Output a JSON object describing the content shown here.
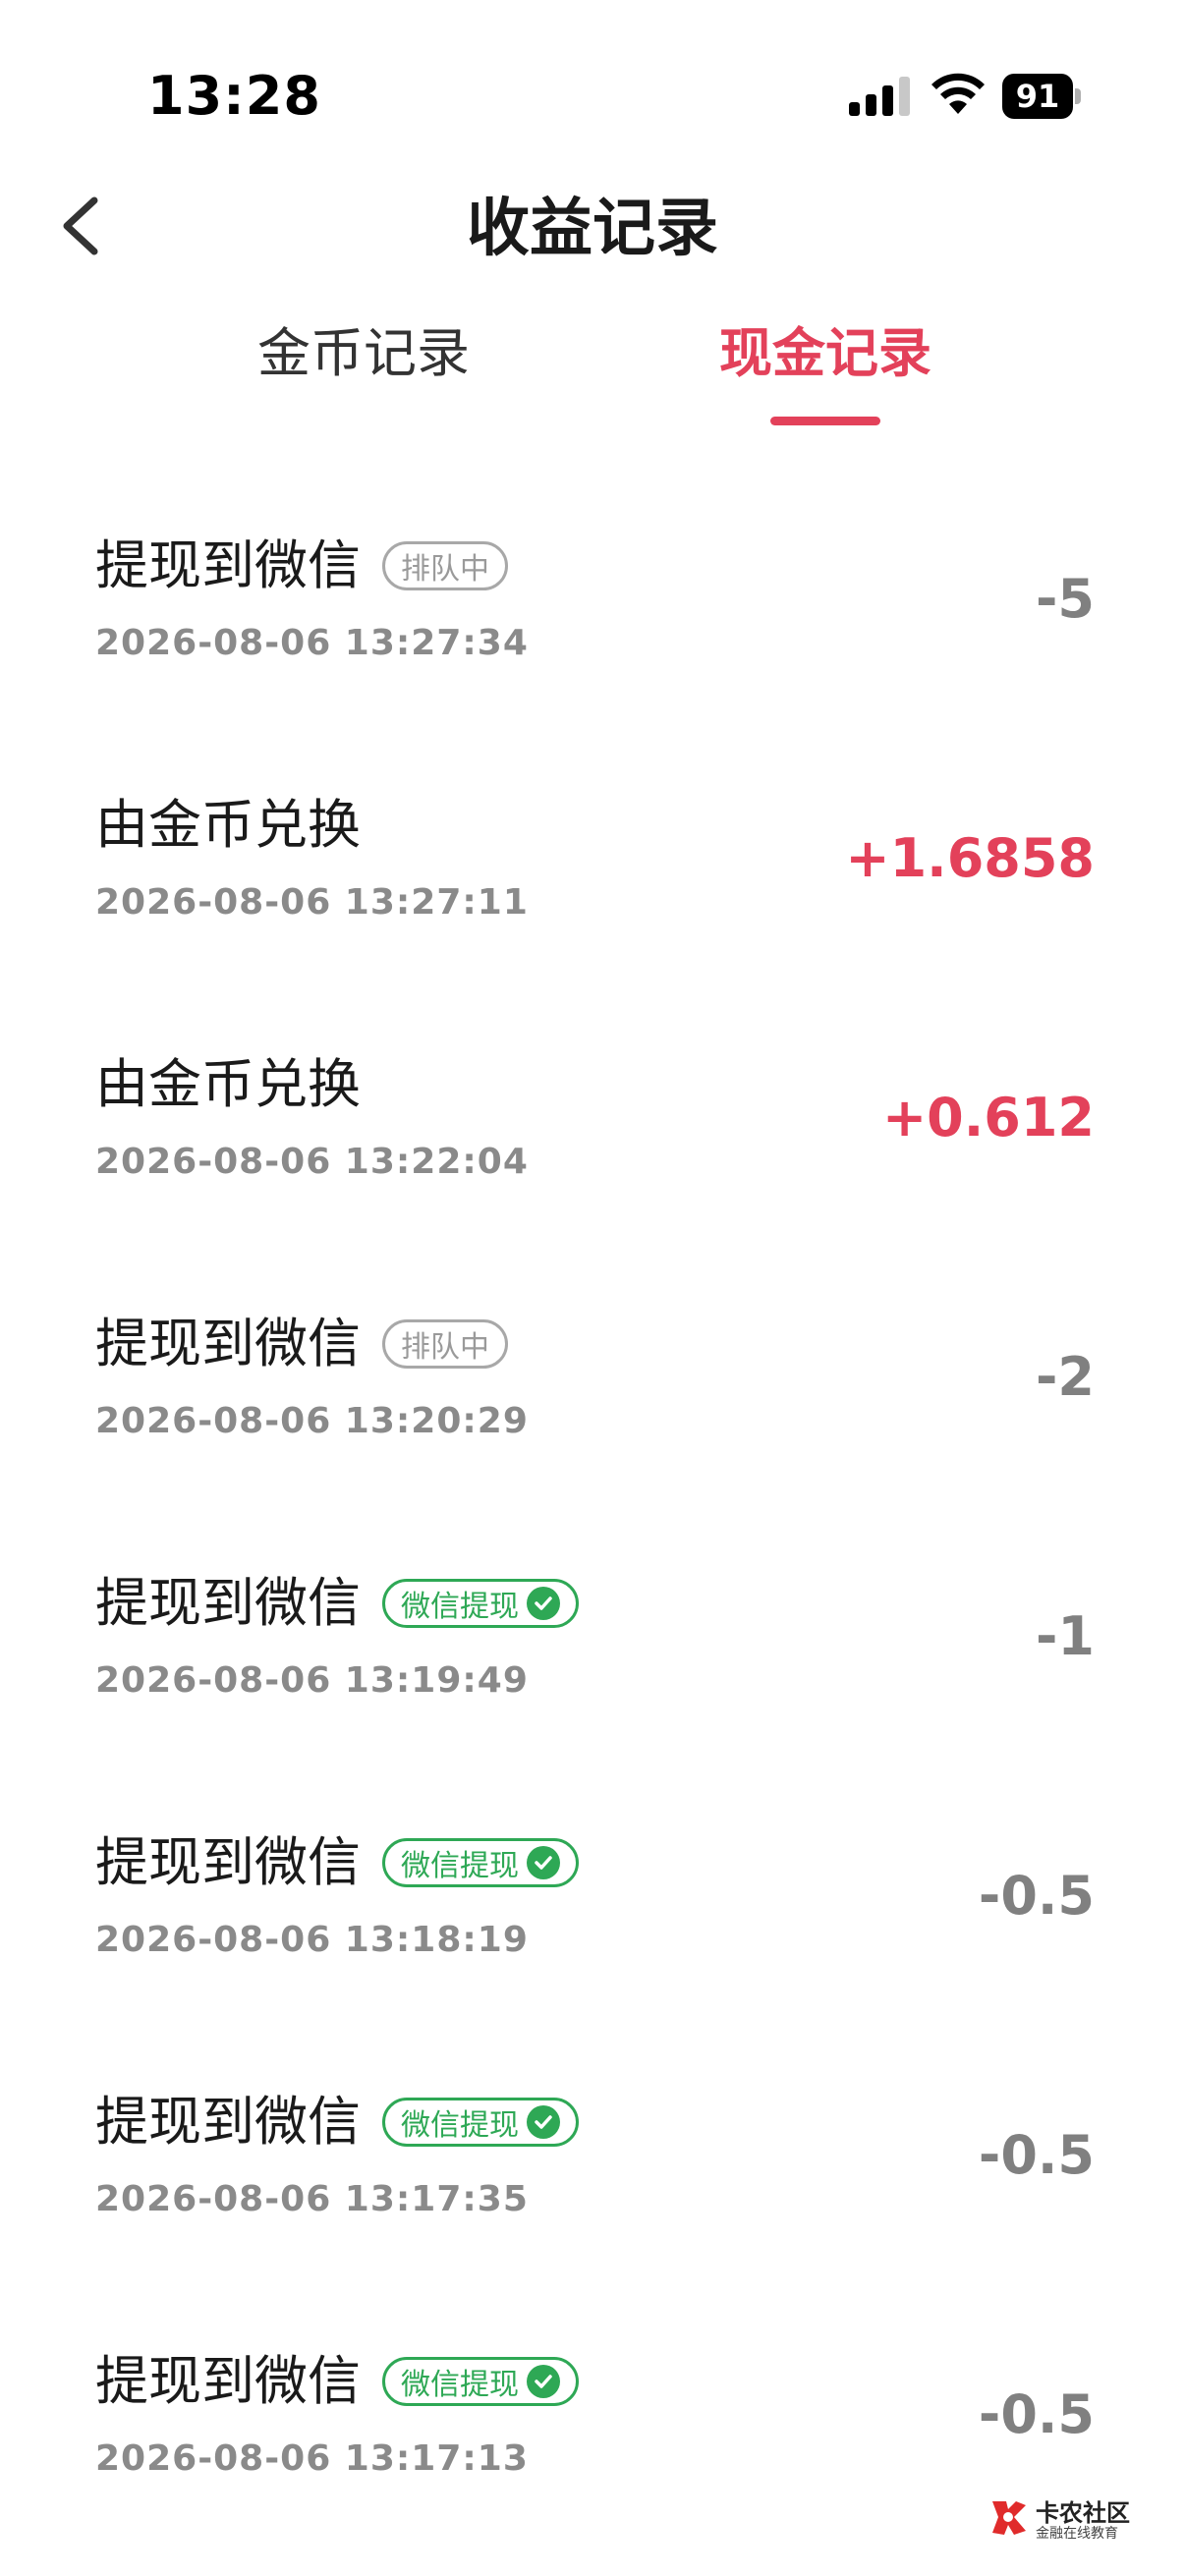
{
  "status_bar": {
    "time": "13:28",
    "battery": "91"
  },
  "header": {
    "title": "收益记录"
  },
  "tabs": [
    {
      "label": "金币记录",
      "active": false
    },
    {
      "label": "现金记录",
      "active": true
    }
  ],
  "colors": {
    "accent": "#e3415a",
    "wechat_green": "#2ea855",
    "negative_amount": "#808080"
  },
  "records": [
    {
      "title": "提现到微信",
      "badge": "排队中",
      "badge_type": "queue",
      "time": "2026-08-06 13:27:34",
      "amount": "-5"
    },
    {
      "title": "由金币兑换",
      "badge": "",
      "badge_type": "none",
      "time": "2026-08-06 13:27:11",
      "amount": "+1.6858"
    },
    {
      "title": "由金币兑换",
      "badge": "",
      "badge_type": "none",
      "time": "2026-08-06 13:22:04",
      "amount": "+0.612"
    },
    {
      "title": "提现到微信",
      "badge": "排队中",
      "badge_type": "queue",
      "time": "2026-08-06 13:20:29",
      "amount": "-2"
    },
    {
      "title": "提现到微信",
      "badge": "微信提现",
      "badge_type": "wechat",
      "time": "2026-08-06 13:19:49",
      "amount": "-1"
    },
    {
      "title": "提现到微信",
      "badge": "微信提现",
      "badge_type": "wechat",
      "time": "2026-08-06 13:18:19",
      "amount": "-0.5"
    },
    {
      "title": "提现到微信",
      "badge": "微信提现",
      "badge_type": "wechat",
      "time": "2026-08-06 13:17:35",
      "amount": "-0.5"
    },
    {
      "title": "提现到微信",
      "badge": "微信提现",
      "badge_type": "wechat",
      "time": "2026-08-06 13:17:13",
      "amount": "-0.5"
    }
  ],
  "watermark": {
    "name": "卡农社区",
    "tagline": "金融在线教育"
  }
}
